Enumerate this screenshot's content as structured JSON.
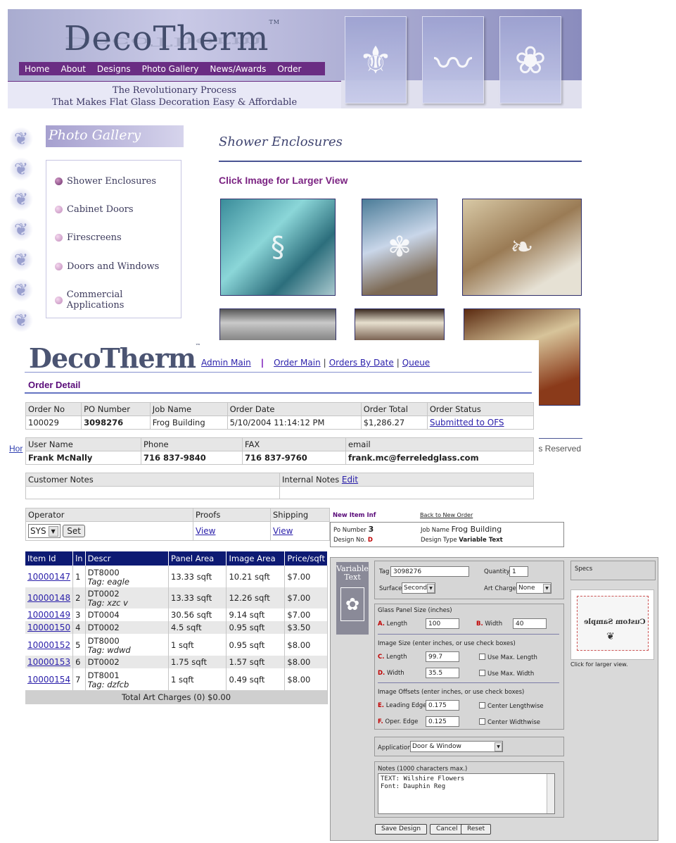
{
  "site": {
    "logo": "DecoTherm",
    "logo_tm": "TM",
    "nav": [
      "Home",
      "About",
      "Designs",
      "Photo Gallery",
      "News/Awards",
      "Order"
    ],
    "tagline_1": "The Revolutionary Process",
    "tagline_2": "That Makes Flat Glass Decoration Easy & Affordable",
    "gallery_title": "Photo Gallery",
    "gallery_items": [
      "Shower Enclosures",
      "Cabinet Doors",
      "Firescreens",
      "Doors and Windows",
      "Commercial Applications"
    ],
    "section_title": "Shower Enclosures",
    "click_prompt": "Click Image for Larger View",
    "home_fragment": "Hor",
    "rights_fragment": "ts Reserved"
  },
  "admin": {
    "logo": "DecoTherm",
    "logo_tm": "™",
    "nav": [
      "Admin Main",
      "Order Main",
      "Orders By Date",
      "Queue"
    ],
    "order_detail_title": "Order Detail",
    "order": {
      "headers": [
        "Order No",
        "PO Number",
        "Job Name",
        "Order Date",
        "Order Total",
        "Order Status"
      ],
      "values": [
        "100029",
        "3098276",
        "Frog Building",
        "5/10/2004 11:14:12 PM",
        "$1,286.27",
        "Submitted to OFS"
      ]
    },
    "user": {
      "headers": [
        "User Name",
        "Phone",
        "FAX",
        "email"
      ],
      "values": [
        "Frank McNally",
        "716 837-9840",
        "716 837-9760",
        "frank.mc@ferreledglass.com"
      ]
    },
    "notes": {
      "customer_label": "Customer Notes",
      "internal_label": "Internal Notes",
      "edit_link": "Edit"
    },
    "operator": {
      "headers": [
        "Operator",
        "Proofs",
        "Shipping"
      ],
      "selected": "SYS",
      "set_button": "Set",
      "proofs_link": "View",
      "shipping_link": "View"
    },
    "items": {
      "headers": [
        "Item Id",
        "ln",
        "Descr",
        "Panel Area",
        "Image Area",
        "Price/sqft"
      ],
      "rows": [
        {
          "id": "10000147",
          "ln": "1",
          "descr": "DT8000",
          "tag": "Tag: eagle",
          "panel": "13.33 sqft",
          "image": "10.21 sqft",
          "price": "$7.00"
        },
        {
          "id": "10000148",
          "ln": "2",
          "descr": "DT0002",
          "tag": "Tag: xzc v",
          "panel": "13.33 sqft",
          "image": "12.26 sqft",
          "price": "$7.00"
        },
        {
          "id": "10000149",
          "ln": "3",
          "descr": "DT0004",
          "tag": "",
          "panel": "30.56 sqft",
          "image": "9.14 sqft",
          "price": "$7.00"
        },
        {
          "id": "10000150",
          "ln": "4",
          "descr": "DT0002",
          "tag": "",
          "panel": "4.5 sqft",
          "image": "0.95 sqft",
          "price": "$3.50"
        },
        {
          "id": "10000152",
          "ln": "5",
          "descr": "DT8000",
          "tag": "Tag: wdwd",
          "panel": "1 sqft",
          "image": "0.95 sqft",
          "price": "$8.00"
        },
        {
          "id": "10000153",
          "ln": "6",
          "descr": "DT0002",
          "tag": "",
          "panel": "1.75 sqft",
          "image": "1.57 sqft",
          "price": "$8.00"
        },
        {
          "id": "10000154",
          "ln": "7",
          "descr": "DT8001",
          "tag": "Tag: dzfcb",
          "panel": "1 sqft",
          "image": "0.49 sqft",
          "price": "$8.00"
        }
      ],
      "footer": "Total Art Charges (0) $0.00"
    }
  },
  "variable": {
    "header": {
      "new_item": "New Item Inf",
      "back_link": "Back to New Order",
      "po_label": "Po Number",
      "po_value": "3",
      "design_no_label": "Design No.",
      "design_no_value": "D",
      "job_label": "Job Name",
      "job_value": "Frog Building",
      "type_label": "Design Type",
      "type_value": "Variable Text"
    },
    "badge": "Variable Text",
    "tag_label": "Tag",
    "tag_value": "3098276",
    "quantity_label": "Quantity",
    "quantity_value": "1",
    "surface_label": "Surface",
    "surface_value": "Second",
    "art_charge_label": "Art Charge",
    "art_charge_value": "None",
    "glass_title": "Glass Panel Size (inches)",
    "a_letter": "A.",
    "length_label": "Length",
    "length_value": "100",
    "b_letter": "B.",
    "width_label": "Width",
    "width_value": "40",
    "image_size_title": "Image Size (enter inches, or use check boxes)",
    "c_letter": "C.",
    "img_length_label": "Length",
    "img_length_value": "99.7",
    "use_max_length": "Use Max. Length",
    "d_letter": "D.",
    "img_width_label": "Width",
    "img_width_value": "35.5",
    "use_max_width": "Use Max. Width",
    "offsets_title": "Image Offsets (enter inches, or use check boxes)",
    "e_letter": "E.",
    "leading_label": "Leading Edge",
    "leading_value": "0.175",
    "center_length": "Center Lengthwise",
    "f_letter": "F.",
    "oper_label": "Oper. Edge",
    "oper_value": "0.125",
    "center_width": "Center Widthwise",
    "application_label": "Application",
    "application_value": "Door & Window",
    "notes_label": "Notes (1000 characters max.)",
    "notes_line1": "TEXT: Wilshire Flowers",
    "notes_line2": "Font: Dauphin Reg",
    "save_button": "Save Design",
    "cancel_button": "Cancel",
    "reset_button": "Reset",
    "specs_title": "Specs",
    "sample_text": "Custom Sample",
    "click_larger": "Click for larger view."
  },
  "colors": {
    "brand_purple": "#6a2d83",
    "nav_blue": "#0d1a73",
    "link": "#2a1faa",
    "title_purple": "#5a0c7a"
  }
}
